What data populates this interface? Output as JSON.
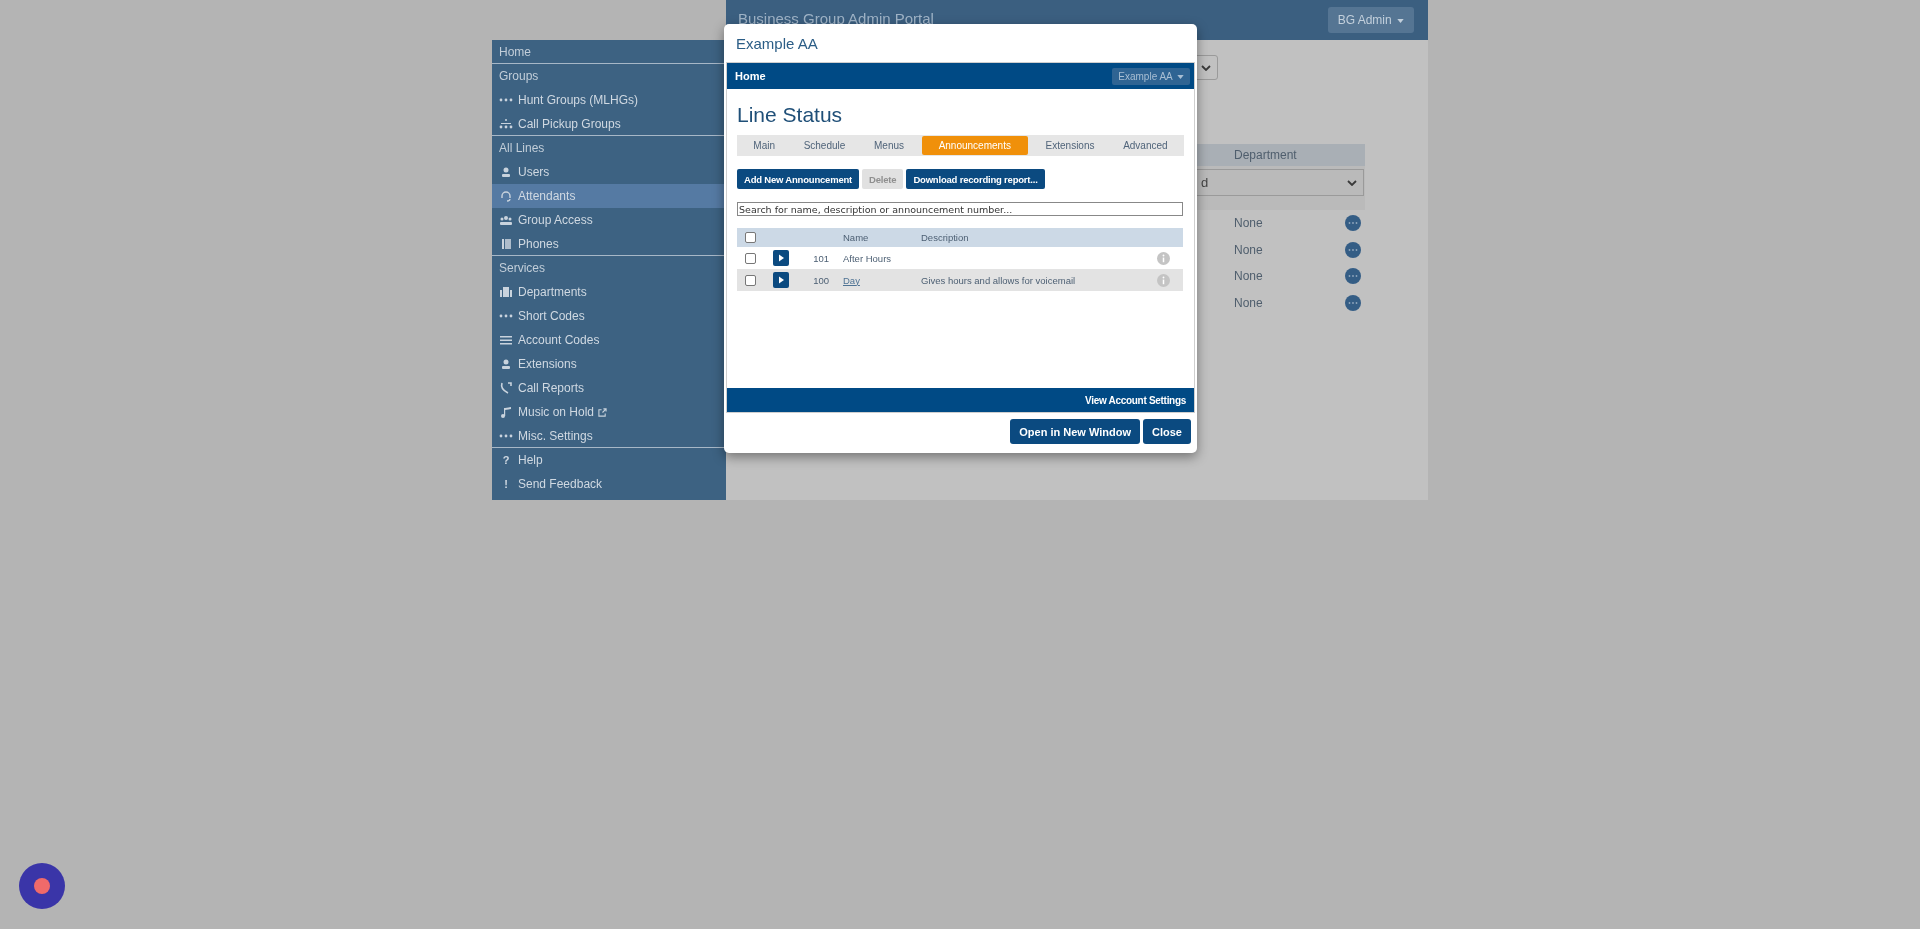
{
  "portal": {
    "title": "Business Group Admin Portal",
    "user_menu": "BG Admin"
  },
  "sidebar": {
    "items": [
      {
        "kind": "section",
        "label": "Home",
        "selected": false
      },
      {
        "kind": "section",
        "label": "Groups",
        "selected": false
      },
      {
        "kind": "link",
        "label": "Hunt Groups (MLHGs)",
        "selected": false
      },
      {
        "kind": "link",
        "label": "Call Pickup Groups",
        "selected": false
      },
      {
        "kind": "section",
        "label": "All Lines",
        "selected": false
      },
      {
        "kind": "link",
        "label": "Users",
        "selected": false
      },
      {
        "kind": "link",
        "label": "Attendants",
        "selected": true
      },
      {
        "kind": "link",
        "label": "Group Access",
        "selected": false
      },
      {
        "kind": "link",
        "label": "Phones",
        "selected": false
      },
      {
        "kind": "section",
        "label": "Services",
        "selected": false
      },
      {
        "kind": "link",
        "label": "Departments",
        "selected": false
      },
      {
        "kind": "link",
        "label": "Short Codes",
        "selected": false
      },
      {
        "kind": "link",
        "label": "Account Codes",
        "selected": false
      },
      {
        "kind": "link",
        "label": "Extensions",
        "selected": false
      },
      {
        "kind": "link",
        "label": "Call Reports",
        "selected": false
      },
      {
        "kind": "external",
        "label": "Music on Hold",
        "selected": false
      },
      {
        "kind": "link",
        "label": "Misc. Settings",
        "selected": false
      },
      {
        "kind": "link",
        "glyph": "?",
        "label": "Help",
        "selected": false
      },
      {
        "kind": "link",
        "glyph": "!",
        "label": "Send Feedback",
        "selected": false
      }
    ]
  },
  "background_table": {
    "header": "Department",
    "filter_value": "d",
    "rows": [
      {
        "department": "None"
      },
      {
        "department": "None"
      },
      {
        "department": "None"
      },
      {
        "department": "None"
      }
    ]
  },
  "dialog": {
    "title": "Example AA",
    "nav": {
      "home": "Home",
      "menu": "Example AA"
    },
    "heading": "Line Status",
    "tabs": [
      {
        "label": "Main",
        "selected": false
      },
      {
        "label": "Schedule",
        "selected": false
      },
      {
        "label": "Menus",
        "selected": false
      },
      {
        "label": "Announcements",
        "selected": true
      },
      {
        "label": "Extensions",
        "selected": false
      },
      {
        "label": "Advanced",
        "selected": false
      }
    ],
    "actions": [
      {
        "label": "Add New Announcement",
        "disabled": false
      },
      {
        "label": "Delete",
        "disabled": true
      },
      {
        "label": "Download recording report...",
        "disabled": false
      }
    ],
    "search": {
      "placeholder": "Search for name, description or announcement number..."
    },
    "select_all_checked": false,
    "columns": [
      "Name",
      "Description"
    ],
    "rows": [
      {
        "checked": false,
        "number": "101",
        "name": "After Hours",
        "link": false,
        "description": ""
      },
      {
        "checked": false,
        "number": "100",
        "name": "Day",
        "link": true,
        "description": "Gives hours and allows for voicemail"
      }
    ],
    "footer_link": "View Account Settings",
    "buttons": [
      "Open in New Window",
      "Close"
    ]
  }
}
